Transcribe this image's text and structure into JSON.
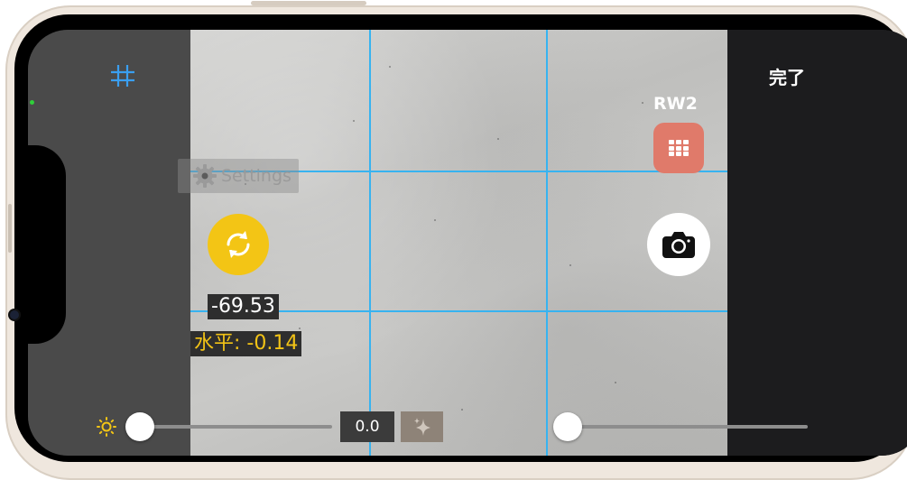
{
  "toolbar": {
    "grid_icon": "grid-icon",
    "done_label": "完了"
  },
  "capture": {
    "format_label": "RW2",
    "photo_grid_icon": "photo-grid-icon",
    "shutter_icon": "camera-icon"
  },
  "settings_overlay": {
    "label": "Settings",
    "icon": "gear-icon"
  },
  "level": {
    "rotate_icon": "rotate-icon",
    "angle_value": "-69.53",
    "horizontal_label": "水平: -0.14"
  },
  "exposure": {
    "icon": "sun-icon",
    "slider_value": 0.0,
    "value_label": "0.0",
    "auto_icon": "sparkle-icon"
  },
  "zoom": {
    "slider_value": 0.0
  },
  "colors": {
    "grid_lines": "#37b3f0",
    "accent_yellow": "#f3c515",
    "photo_button": "#e07a6a",
    "grid_toggle": "#3a9ff0"
  }
}
